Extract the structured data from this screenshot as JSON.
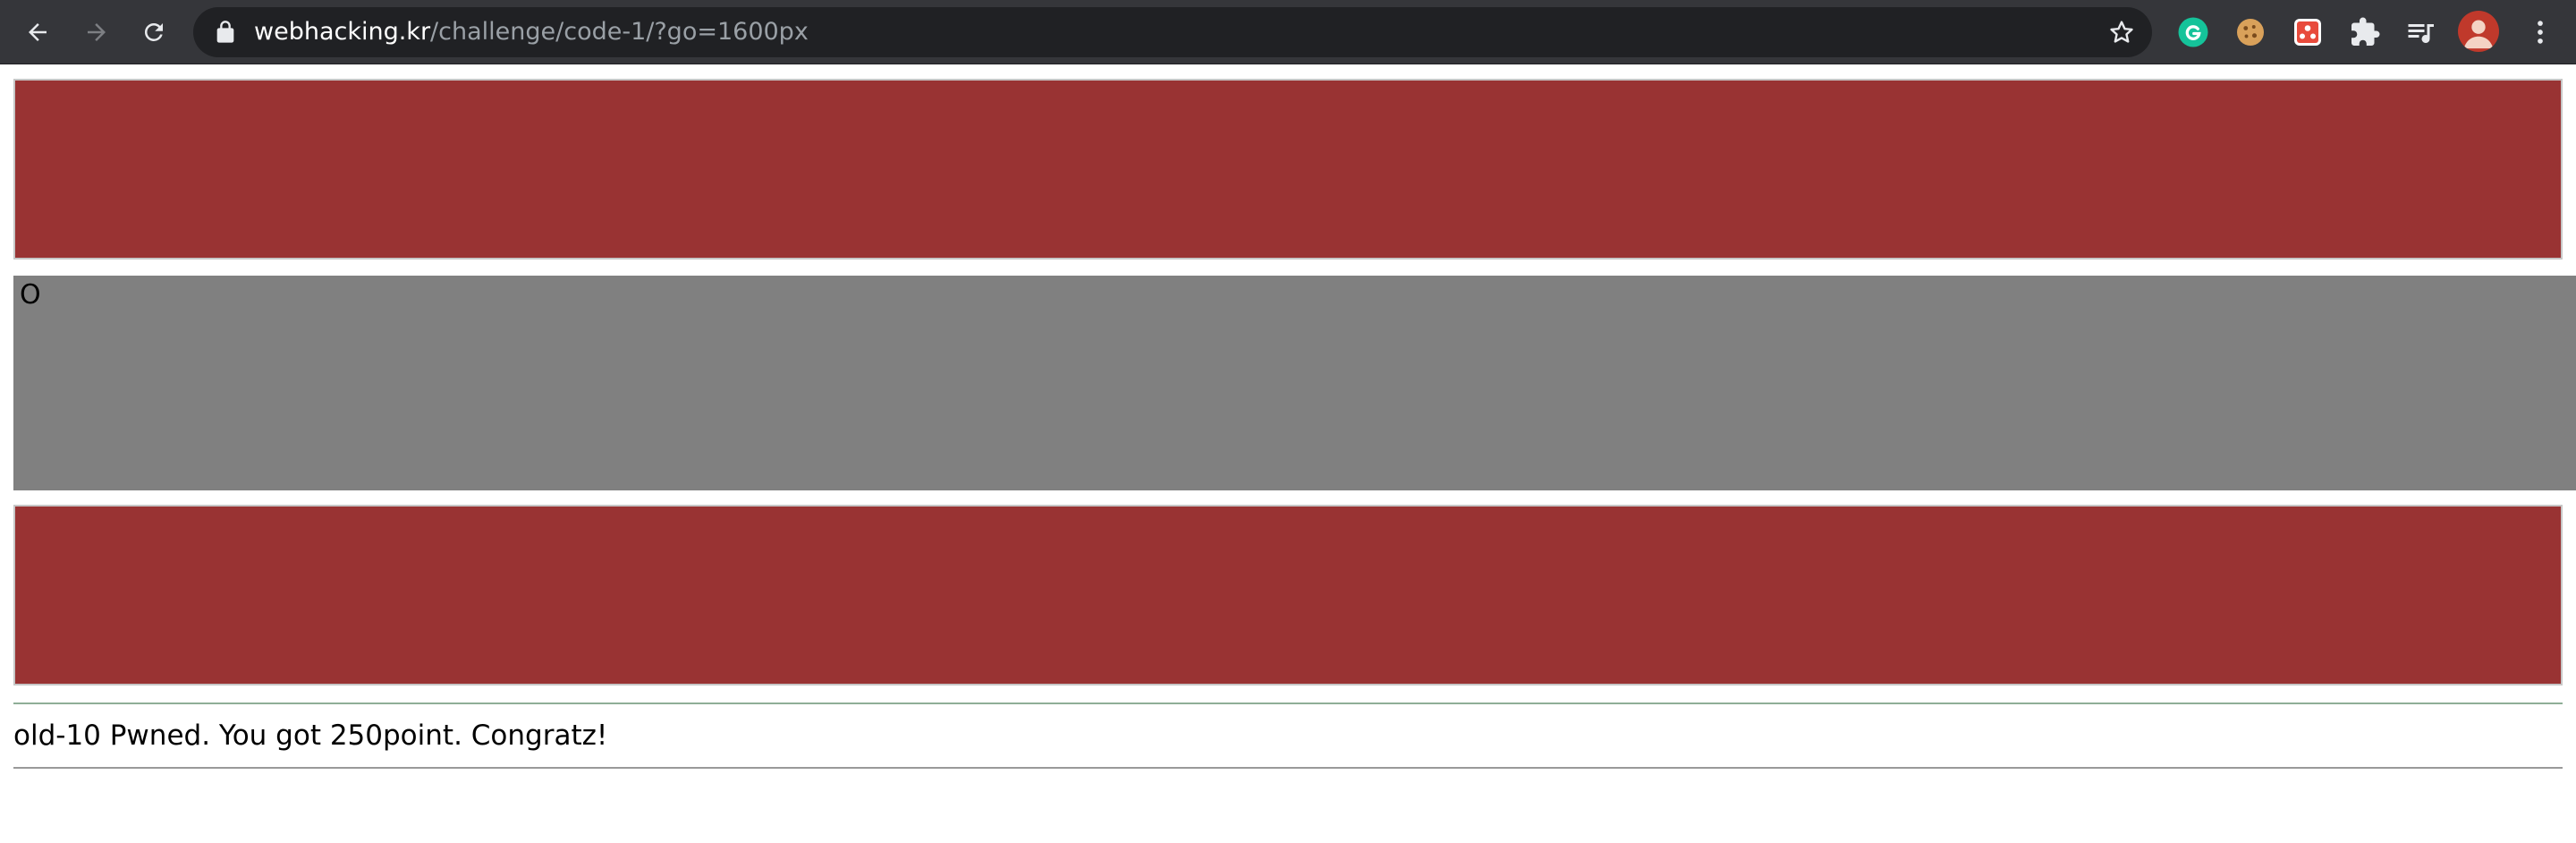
{
  "browser": {
    "url_host": "webhacking.kr",
    "url_path": "/challenge/code-1/?go=1600px",
    "icons": [
      "back-icon",
      "forward-icon",
      "reload-icon",
      "lock-icon",
      "star-icon",
      "grammarly-icon",
      "cookie-icon",
      "extension-icon",
      "puzzle-icon",
      "media-queue-icon",
      "avatar",
      "menu-icon"
    ],
    "colors": {
      "toolbar": "#35363a",
      "omnibox": "#202124"
    }
  },
  "page": {
    "runner_char": "O",
    "message": "old-10 Pwned. You got 250point. Congratz!",
    "colors": {
      "red_bar": "#993333",
      "track": "#808080"
    }
  }
}
